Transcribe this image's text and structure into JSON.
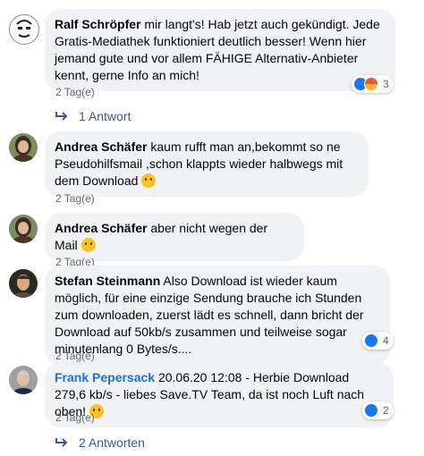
{
  "comments": [
    {
      "author": "Ralf Schröpfer",
      "text": "mir langt's! Hab jetzt auch gekündigt. Jede Gratis-Mediathek funktioniert deutlich besser! Wenn hier jemand gute und vor allem FÄHIGE Alternativ-Anbieter kennt, gerne Info an mich!",
      "time": "2 Tag(e)",
      "reaction_count": "3",
      "replies_label": "1 Antwort"
    },
    {
      "author": "Andrea Schäfer",
      "text": "kaum rufft man an,bekommt so ne Pseudohilfsmail ,schon klappts wieder halbwegs mit dem Download",
      "time": "2 Tag(e)"
    },
    {
      "author": "Andrea Schäfer",
      "text": "aber nicht wegen der Mail",
      "time": "2 Tag(e)"
    },
    {
      "author": "Stefan Steinmann",
      "text": "Also Download ist wieder kaum möglich, für eine einzige Sendung brauche ich Stunden zum downloaden, zuerst lädt es schnell, dann bricht der Download auf 50kb/s zusammen und teilweise sogar minutenlang 0 Bytes/s....",
      "time": "2 Tag(e)",
      "reaction_count": "4"
    },
    {
      "author": "Frank Pepersack",
      "text": "20.06.20 12:08 - Herbie Download 279,6 kb/s - liebes Save.TV Team, da ist noch Luft nach oben!",
      "time": "2 Tag(e)",
      "reaction_count": "2",
      "replies_label": "2 Antworten"
    }
  ],
  "colors": {
    "bubble": "#f0f2f5",
    "link": "#216fdb",
    "meta": "#65676b",
    "like": "#1877f2"
  }
}
